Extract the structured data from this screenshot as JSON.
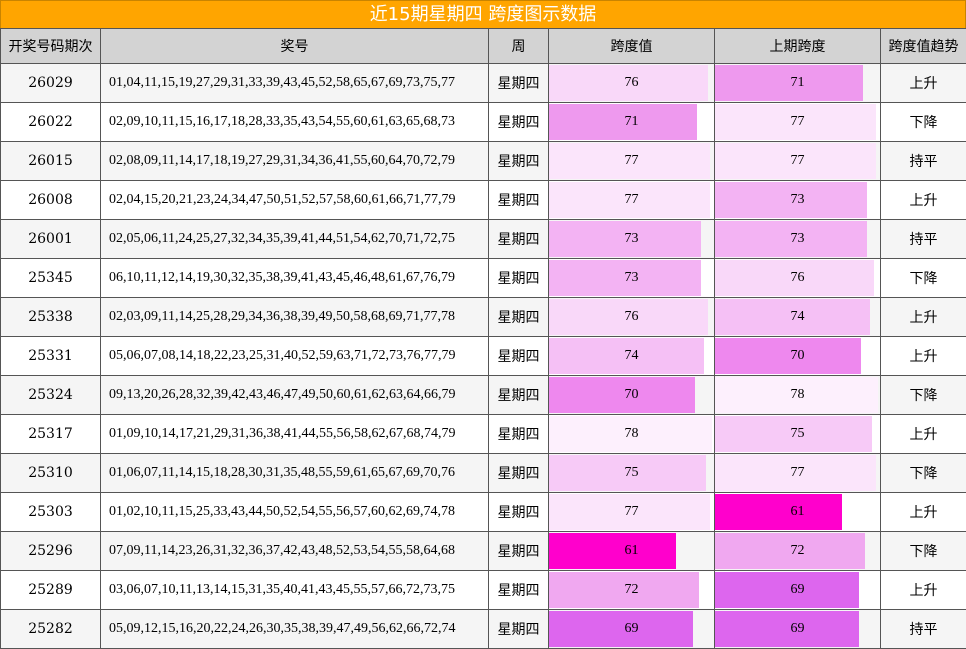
{
  "title": "近15期星期四 跨度图示数据",
  "headers": [
    "开奖号码期次",
    "奖号",
    "周",
    "跨度值",
    "上期跨度",
    "跨度值趋势"
  ],
  "bar_max": 79,
  "rows": [
    {
      "period": "26029",
      "numbers": "01,04,11,15,19,27,29,31,33,39,43,45,52,58,65,67,69,73,75,77",
      "weekday": "星期四",
      "span": 76,
      "prev_span": 71,
      "trend": "上升"
    },
    {
      "period": "26022",
      "numbers": "02,09,10,11,15,16,17,18,28,33,35,43,54,55,60,61,63,65,68,73",
      "weekday": "星期四",
      "span": 71,
      "prev_span": 77,
      "trend": "下降"
    },
    {
      "period": "26015",
      "numbers": "02,08,09,11,14,17,18,19,27,29,31,34,36,41,55,60,64,70,72,79",
      "weekday": "星期四",
      "span": 77,
      "prev_span": 77,
      "trend": "持平"
    },
    {
      "period": "26008",
      "numbers": "02,04,15,20,21,23,24,34,47,50,51,52,57,58,60,61,66,71,77,79",
      "weekday": "星期四",
      "span": 77,
      "prev_span": 73,
      "trend": "上升"
    },
    {
      "period": "26001",
      "numbers": "02,05,06,11,24,25,27,32,34,35,39,41,44,51,54,62,70,71,72,75",
      "weekday": "星期四",
      "span": 73,
      "prev_span": 73,
      "trend": "持平"
    },
    {
      "period": "25345",
      "numbers": "06,10,11,12,14,19,30,32,35,38,39,41,43,45,46,48,61,67,76,79",
      "weekday": "星期四",
      "span": 73,
      "prev_span": 76,
      "trend": "下降"
    },
    {
      "period": "25338",
      "numbers": "02,03,09,11,14,25,28,29,34,36,38,39,49,50,58,68,69,71,77,78",
      "weekday": "星期四",
      "span": 76,
      "prev_span": 74,
      "trend": "上升"
    },
    {
      "period": "25331",
      "numbers": "05,06,07,08,14,18,22,23,25,31,40,52,59,63,71,72,73,76,77,79",
      "weekday": "星期四",
      "span": 74,
      "prev_span": 70,
      "trend": "上升"
    },
    {
      "period": "25324",
      "numbers": "09,13,20,26,28,32,39,42,43,46,47,49,50,60,61,62,63,64,66,79",
      "weekday": "星期四",
      "span": 70,
      "prev_span": 78,
      "trend": "下降"
    },
    {
      "period": "25317",
      "numbers": "01,09,10,14,17,21,29,31,36,38,41,44,55,56,58,62,67,68,74,79",
      "weekday": "星期四",
      "span": 78,
      "prev_span": 75,
      "trend": "上升"
    },
    {
      "period": "25310",
      "numbers": "01,06,07,11,14,15,18,28,30,31,35,48,55,59,61,65,67,69,70,76",
      "weekday": "星期四",
      "span": 75,
      "prev_span": 77,
      "trend": "下降"
    },
    {
      "period": "25303",
      "numbers": "01,02,10,11,15,25,33,43,44,50,52,54,55,56,57,60,62,69,74,78",
      "weekday": "星期四",
      "span": 77,
      "prev_span": 61,
      "trend": "上升"
    },
    {
      "period": "25296",
      "numbers": "07,09,11,14,23,26,31,32,36,37,42,43,48,52,53,54,55,58,64,68",
      "weekday": "星期四",
      "span": 61,
      "prev_span": 72,
      "trend": "下降"
    },
    {
      "period": "25289",
      "numbers": "03,06,07,10,11,13,14,15,31,35,40,41,43,45,55,57,66,72,73,75",
      "weekday": "星期四",
      "span": 72,
      "prev_span": 69,
      "trend": "上升"
    },
    {
      "period": "25282",
      "numbers": "05,09,12,15,16,20,22,24,26,30,35,38,39,47,49,56,62,66,72,74",
      "weekday": "星期四",
      "span": 69,
      "prev_span": 69,
      "trend": "持平"
    }
  ],
  "bar_colors": {
    "61": "#ff00cc",
    "69": "#dd66ee",
    "70": "#ee88ee",
    "71": "#ee99ee",
    "72": "#f0a8f0",
    "73": "#f3b3f3",
    "74": "#f5c0f5",
    "75": "#f7caf7",
    "76": "#f9d8f9",
    "77": "#fbe5fb",
    "78": "#fdf0fd"
  }
}
